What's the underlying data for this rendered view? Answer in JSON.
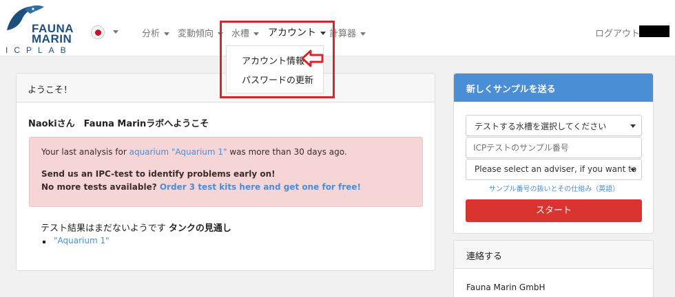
{
  "header": {
    "logo": {
      "line1": "FAUNA",
      "line2": "MARIN",
      "sub": "ICPLAB"
    },
    "nav": [
      {
        "label": "分析"
      },
      {
        "label": "変動傾向"
      },
      {
        "label": "水槽"
      },
      {
        "label": "アカウント"
      },
      {
        "label": "計算器"
      }
    ],
    "logout": "ログアウト"
  },
  "dropdown": {
    "items": [
      "アカウント情報",
      "パスワードの更新"
    ]
  },
  "welcome_card": {
    "title": "ようこそ！",
    "greeting": "Naokiさん　Fauna Marinラボへようこそ",
    "alert": {
      "pre": "Your last analysis for ",
      "link": "aquarium \"Aquarium 1\"",
      "post": " was more than 30 days ago.",
      "line2": "Send us an IPC-test to identify problems early on!",
      "line3_pre": "No more tests available? ",
      "line3_link": "Order 3 test kits here and get one for free!"
    },
    "results_pre": "テスト結果はまだないようです ",
    "results_bold": "タンクの見通し",
    "aquarium_link": "\"Aquarium 1\""
  },
  "send_card": {
    "title": "新しくサンプルを送る",
    "tank_select": "テストする水槽を選択してください",
    "sample_placeholder": "ICPテストのサンプル番号",
    "adviser_select": "Please select an adviser, if you want to",
    "help_link": "サンプル番号の扱いとその仕組み（英語）",
    "start_label": "スタート"
  },
  "contact_card": {
    "title": "連絡する",
    "company": "Fauna Marin GmbH"
  },
  "colors": {
    "accent": "#4a8ed6",
    "danger": "#d9342f",
    "alert_bg": "#f5d5d6",
    "highlight": "#d6262c",
    "brand": "#1c4f7e"
  }
}
